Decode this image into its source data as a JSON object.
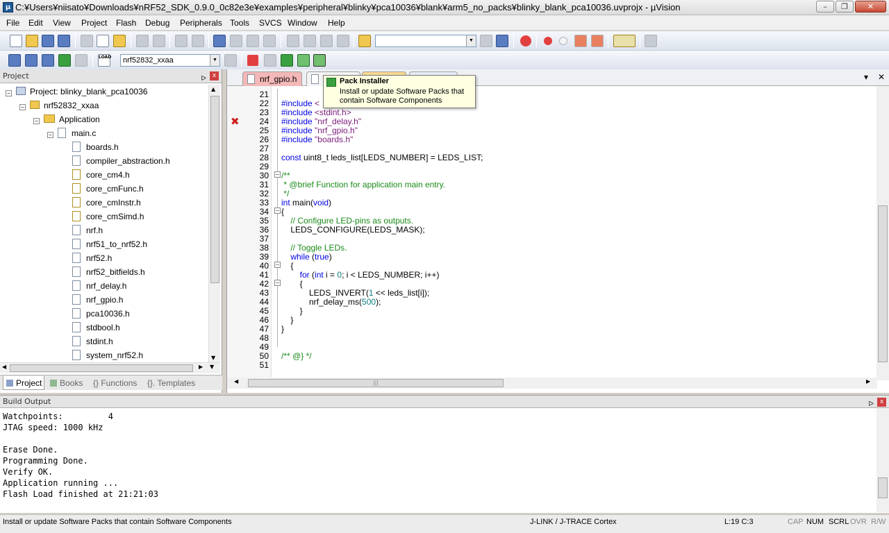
{
  "window": {
    "title": "C:¥Users¥niisato¥Downloads¥nRF52_SDK_0.9.0_0c82e3e¥examples¥peripheral¥blinky¥pca10036¥blank¥arm5_no_packs¥blinky_blank_pca10036.uvprojx - µVision",
    "app_icon": "uvision-icon",
    "minimize": "–",
    "restore": "❐",
    "close": "✕"
  },
  "menu": [
    "File",
    "Edit",
    "View",
    "Project",
    "Flash",
    "Debug",
    "Peripherals",
    "Tools",
    "SVCS",
    "Window",
    "Help"
  ],
  "toolbar": {
    "target_select": "nrf52832_xxaa",
    "load_label": "LOAD",
    "search_combo": ""
  },
  "project_panel": {
    "title": "Project",
    "pin": "ᐅ",
    "close": "x",
    "root": "Project: blinky_blank_pca10036",
    "target": "nrf52832_xxaa",
    "group": "Application",
    "source": "main.c",
    "files": [
      "boards.h",
      "compiler_abstraction.h",
      "core_cm4.h",
      "core_cmFunc.h",
      "core_cmInstr.h",
      "core_cmSimd.h",
      "nrf.h",
      "nrf51_to_nrf52.h",
      "nrf52.h",
      "nrf52_bitfields.h",
      "nrf_delay.h",
      "nrf_gpio.h",
      "pca10036.h",
      "stdbool.h",
      "stdint.h",
      "system_nrf52.h"
    ],
    "tabs": [
      "Project",
      "Books",
      "{} Functions",
      "{}. Templates"
    ]
  },
  "editor": {
    "active_tab": "nrf_gpio.h",
    "tab_menu": "▾",
    "tab_close": "✕",
    "lines": [
      {
        "n": "21",
        "t": ""
      },
      {
        "n": "22",
        "t": "#include <"
      },
      {
        "n": "23",
        "t": "#include <stdint.h>"
      },
      {
        "n": "24",
        "t": "#include \"nrf_delay.h\""
      },
      {
        "n": "25",
        "t": "#include \"nrf_gpio.h\""
      },
      {
        "n": "26",
        "t": "#include \"boards.h\""
      },
      {
        "n": "27",
        "t": ""
      },
      {
        "n": "28",
        "t": "const uint8_t leds_list[LEDS_NUMBER] = LEDS_LIST;"
      },
      {
        "n": "29",
        "t": ""
      },
      {
        "n": "30",
        "t": "/**"
      },
      {
        "n": "31",
        "t": " * @brief Function for application main entry."
      },
      {
        "n": "32",
        "t": " */"
      },
      {
        "n": "33",
        "t": "int main(void)"
      },
      {
        "n": "34",
        "t": "{"
      },
      {
        "n": "35",
        "t": "    // Configure LED-pins as outputs."
      },
      {
        "n": "36",
        "t": "    LEDS_CONFIGURE(LEDS_MASK);"
      },
      {
        "n": "37",
        "t": ""
      },
      {
        "n": "38",
        "t": "    // Toggle LEDs."
      },
      {
        "n": "39",
        "t": "    while (true)"
      },
      {
        "n": "40",
        "t": "    {"
      },
      {
        "n": "41",
        "t": "        for (int i = 0; i < LEDS_NUMBER; i++)"
      },
      {
        "n": "42",
        "t": "        {"
      },
      {
        "n": "43",
        "t": "            LEDS_INVERT(1 << leds_list[i]);"
      },
      {
        "n": "44",
        "t": "            nrf_delay_ms(500);"
      },
      {
        "n": "45",
        "t": "        }"
      },
      {
        "n": "46",
        "t": "    }"
      },
      {
        "n": "47",
        "t": "}"
      },
      {
        "n": "48",
        "t": ""
      },
      {
        "n": "49",
        "t": ""
      },
      {
        "n": "50",
        "t": "/** @} */"
      },
      {
        "n": "51",
        "t": ""
      }
    ],
    "fold_marker": "−",
    "error_marker": "✖"
  },
  "tooltip": {
    "title": "Pack Installer",
    "text": "Install or update Software Packs that contain Software Components"
  },
  "build_output": {
    "title": "Build Output",
    "text": "Watchpoints:         4\nJTAG speed: 1000 kHz\n\nErase Done.\nProgramming Done.\nVerify OK.\nApplication running ...\nFlash Load finished at 21:21:03"
  },
  "statusbar": {
    "message": "Install or update Software Packs that contain Software Components",
    "debugger": "J-LINK / J-TRACE Cortex",
    "position": "L:19 C:3",
    "cap": "CAP",
    "num": "NUM",
    "scrl": "SCRL",
    "ovr": "OVR",
    "rw": "R/W"
  }
}
